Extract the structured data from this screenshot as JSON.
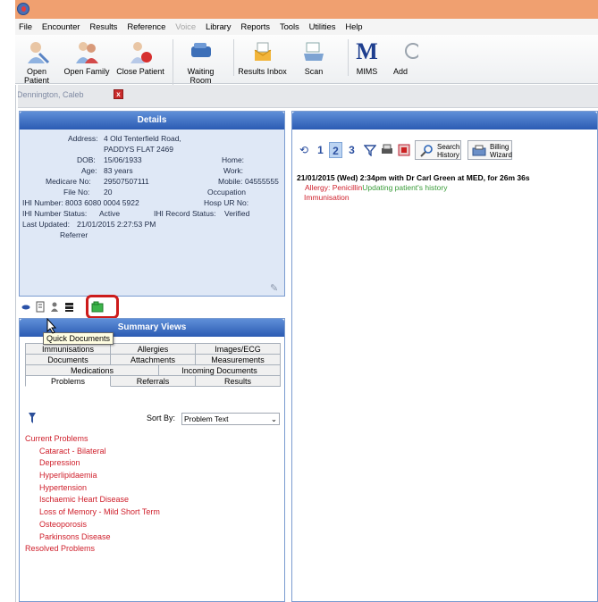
{
  "menu": [
    "File",
    "Encounter",
    "Results",
    "Reference",
    "Voice",
    "Library",
    "Reports",
    "Tools",
    "Utilities",
    "Help"
  ],
  "menu_disabled": [
    "Voice"
  ],
  "toolbar": {
    "open_patient": "Open Patient",
    "open_family": "Open Family",
    "close_patient": "Close Patient",
    "waiting_room": "Waiting Room",
    "results_inbox": "Results Inbox",
    "scan": "Scan",
    "mims": "MIMS",
    "mims_logo": "M",
    "add": "Add"
  },
  "patient_tab": {
    "name": "Dennington, Caleb",
    "close": "x"
  },
  "details": {
    "title": "Details",
    "address_label": "Address:",
    "address_line1": "4 Old Tenterfield Road,",
    "address_line2": "PADDYS FLAT  2469",
    "dob_label": "DOB:",
    "dob": "15/06/1933",
    "age_label": "Age:",
    "age": "83 years",
    "medicare_label": "Medicare No:",
    "medicare": "29507507111",
    "file_label": "File No:",
    "file": "20",
    "ihi_label": "IHI Number:",
    "ihi": "8003 6080 0004 5922",
    "ihi_status_label": "IHI Number Status:",
    "ihi_status": "Active",
    "ihi_record_label": "IHI Record Status:",
    "ihi_record": "Verified",
    "last_updated_label": "Last Updated:",
    "last_updated": "21/01/2015 2:27:53 PM",
    "referrer_label": "Referrer",
    "home_label": "Home:",
    "work_label": "Work:",
    "mobile_label": "Mobile:",
    "mobile": "04555555",
    "occupation_label": "Occupation",
    "hosp_label": "Hosp UR No:"
  },
  "tooltip": "Quick Documents",
  "summary": {
    "title": "Summary Views",
    "tabs_row1": [
      "Immunisations",
      "Allergies",
      "Images/ECG"
    ],
    "tabs_row2": [
      "Documents",
      "Attachments",
      "Measurements"
    ],
    "tabs_row3": [
      "Medications",
      "Incoming Documents"
    ],
    "tabs_row4": [
      "Problems",
      "Referrals",
      "Results"
    ],
    "sort_label": "Sort By:",
    "sort_value": "Problem Text",
    "current_header": "Current Problems",
    "problems": [
      "Cataract - Bilateral",
      "Depression",
      "Hyperlipidaemia",
      "Hypertension",
      "Ischaemic Heart Disease",
      "Loss of Memory - Mild Short Term",
      "Osteoporosis",
      "Parkinsons Disease"
    ],
    "resolved_header": "Resolved Problems"
  },
  "right": {
    "pages": [
      "1",
      "2",
      "3"
    ],
    "search_history": [
      "Search",
      "History"
    ],
    "billing_wizard": [
      "Billing",
      "Wizard"
    ],
    "encounter_header": "21/01/2015 (Wed) 2:34pm with Dr Carl Green at MED, for 26m 36s",
    "allergy_label": "Allergy:",
    "allergy_value": "Penicillin",
    "allergy_note": "Updating patient's history",
    "immunisation": "Immunisation"
  },
  "colors": {
    "accent_red": "#cf1f2b",
    "header_blue": "#2b5bb3",
    "green_note": "#3a9c3a",
    "highlight": "#cc1b1b"
  }
}
